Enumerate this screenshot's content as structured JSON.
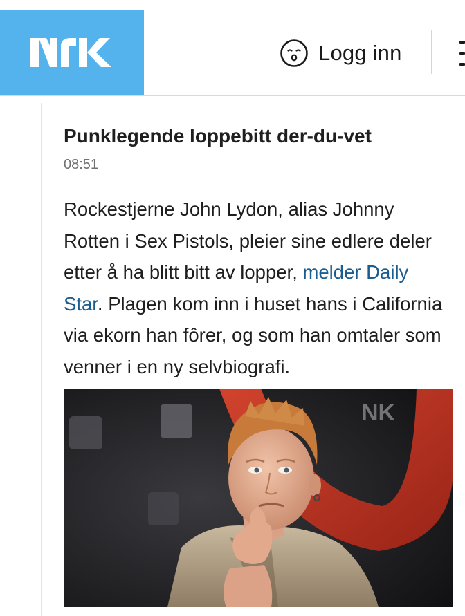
{
  "header": {
    "logo_text": "NRK",
    "login_label": "Logg inn",
    "login_icon": "user-face-icon",
    "menu_icon": "more-vertical-icon",
    "brand_color": "#54b3ec"
  },
  "article": {
    "title": "Punklegende loppebitt der-du-vet",
    "time": "08:51",
    "body_part1": "Rockestjerne John Lydon, alias Johnny Rotten i Sex Pistols, pleier sine edlere deler etter å ha blitt bitt av lopper, ",
    "link_text": "melder Daily Star",
    "body_part2": ". Plagen kom inn i huset hans i California via ekorn han fôrer, og som han omtaler som venner i en ny selvbiografi.",
    "link_color": "#1c5d8f"
  },
  "photo": {
    "backdrop_text": "NK"
  }
}
